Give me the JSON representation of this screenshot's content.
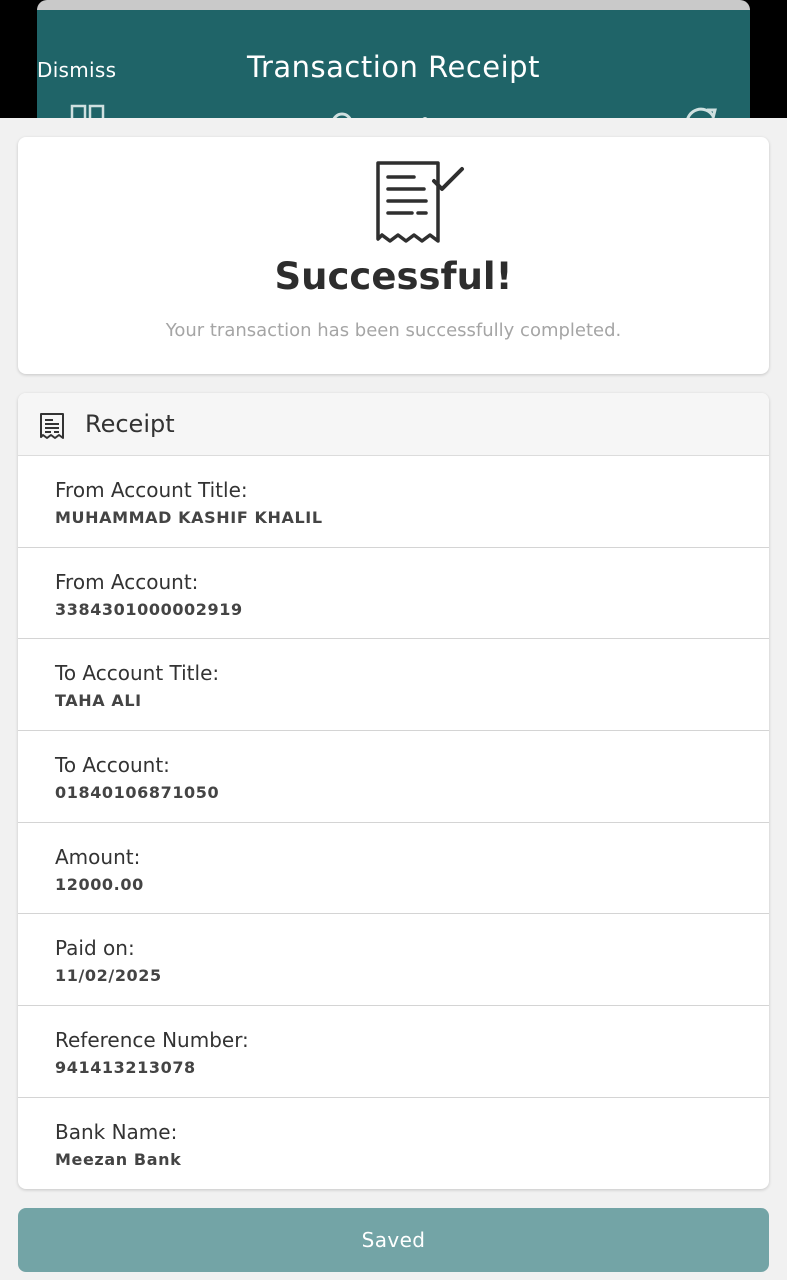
{
  "header": {
    "dismiss_label": "Dismiss",
    "title": "Transaction Receipt"
  },
  "success": {
    "title": "Successful!",
    "subtitle": "Your transaction has been successfully completed."
  },
  "receipt": {
    "heading": "Receipt",
    "rows": [
      {
        "label": "From Account Title:",
        "value": "MUHAMMAD KASHIF KHALIL"
      },
      {
        "label": "From Account:",
        "value": "3384301000002919"
      },
      {
        "label": "To Account Title:",
        "value": "TAHA ALI"
      },
      {
        "label": "To Account:",
        "value": "01840106871050"
      },
      {
        "label": "Amount:",
        "value": "12000.00"
      },
      {
        "label": "Paid on:",
        "value": "11/02/2025"
      },
      {
        "label": "Reference Number:",
        "value": "941413213078"
      },
      {
        "label": "Bank Name:",
        "value": "Meezan Bank"
      }
    ]
  },
  "actions": {
    "saved_label": "Saved"
  },
  "colors": {
    "header_bg": "#1f6468",
    "button_bg": "#73a4a6",
    "page_bg": "#f1f1f1"
  },
  "icons": {
    "header_left": "grid-icon",
    "header_right": "refresh-icon",
    "success": "receipt-check-icon",
    "receipt_heading": "receipt-icon"
  }
}
